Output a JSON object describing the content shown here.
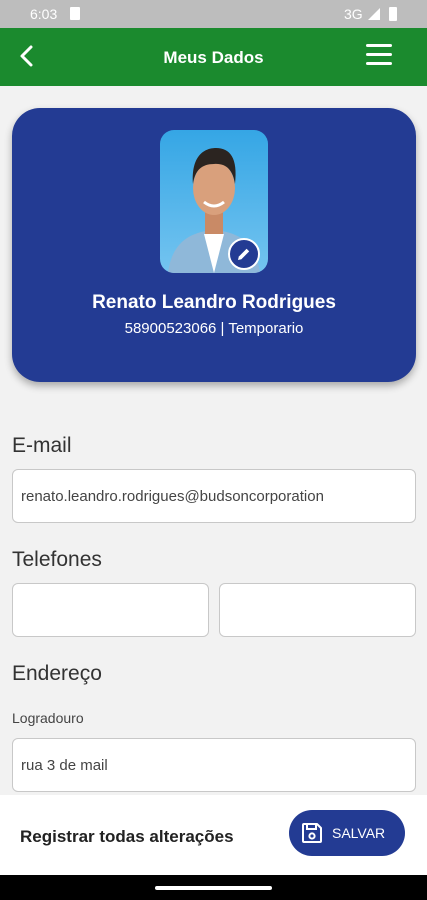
{
  "status_bar": {
    "time": "6:03",
    "network": "3G"
  },
  "app_bar": {
    "title": "Meus Dados"
  },
  "profile": {
    "name": "Renato Leandro Rodrigues",
    "subinfo": "58900523066 | Temporario"
  },
  "form": {
    "email_label": "E-mail",
    "email_value": "renato.leandro.rodrigues@budsoncorporation",
    "phones_label": "Telefones",
    "phone1_value": "",
    "phone2_value": "",
    "address_label": "Endereço",
    "street_label": "Logradouro",
    "street_value": "rua 3 de mail"
  },
  "bottom_bar": {
    "text": "Registrar todas alterações",
    "save_label": "SALVAR"
  },
  "colors": {
    "app_bar": "#1b8a2e",
    "accent": "#233b93",
    "background": "#f2f2f2"
  }
}
